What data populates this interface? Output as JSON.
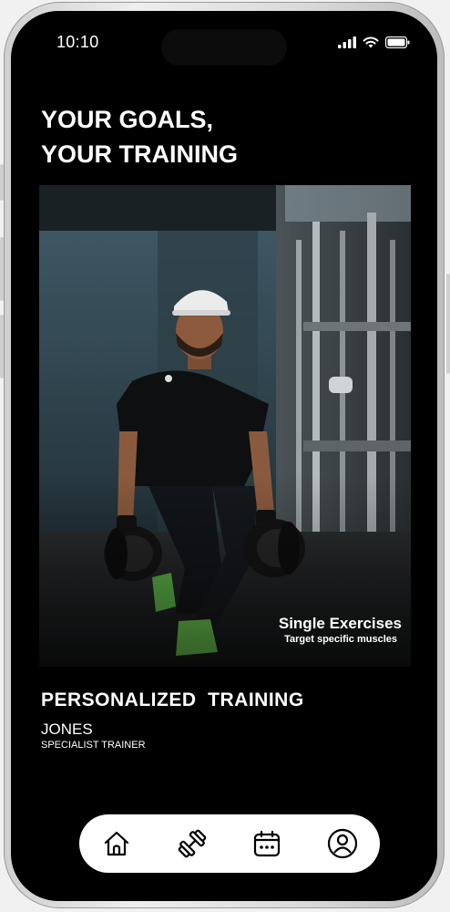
{
  "status_bar": {
    "time": "10:10"
  },
  "headline": {
    "line1": "YOUR GOALS,",
    "line2": "YOUR TRAINING"
  },
  "hero_card": {
    "title": "Single Exercises",
    "subtitle": "Target specific muscles"
  },
  "section": {
    "title": "PERSONALIZED  TRAINING"
  },
  "trainer": {
    "name": "JONES",
    "role": "SPECIALIST TRAINER"
  },
  "bottom_nav": {
    "items": [
      {
        "icon": "home-icon"
      },
      {
        "icon": "dumbbell-icon"
      },
      {
        "icon": "calendar-icon"
      },
      {
        "icon": "profile-icon"
      }
    ]
  },
  "colors": {
    "background": "#000000",
    "nav_background": "#ffffff",
    "text": "#ffffff",
    "shoe_accent": "#7ed957"
  }
}
